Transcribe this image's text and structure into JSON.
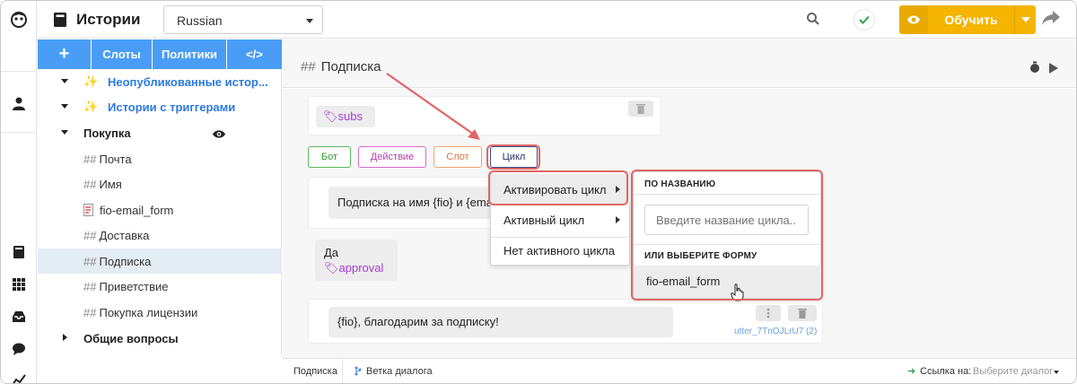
{
  "header": {
    "title": "Истории",
    "language": "Russian",
    "train_label": "Обучить"
  },
  "story_toolbar": {
    "add": "+",
    "slots": "Слоты",
    "policies": "Политики",
    "code": "</>"
  },
  "tree": {
    "unpublished": "Неопубликованные истор...",
    "triggers": "Истории с триггерами",
    "purchase": "Покупка",
    "items": [
      "Почта",
      "Имя",
      "fio-email_form",
      "Доставка",
      "Подписка",
      "Приветствие",
      "Покупка лицензии"
    ],
    "general": "Общие вопросы",
    "hash": "##",
    "sparkle": "✨"
  },
  "story": {
    "title": "Подписка",
    "hash": "##",
    "intent_tag": "subs",
    "chips": [
      "Бот",
      "Действие",
      "Слот",
      "Цикл"
    ],
    "bot_message": "Подписка на имя {fio} и {ema",
    "user_text": "Да",
    "user_tag": "approval",
    "bot_thanks": "{fio}, благодарим за подписку!",
    "utter_ref": "utter_7TnOJLrU7",
    "utter_count": "(2)"
  },
  "cycle_menu": {
    "items": [
      "Активировать цикл",
      "Активный цикл",
      "Нет активного цикла"
    ]
  },
  "sub_menu": {
    "by_name": "ПО НАЗВАНИЮ",
    "search_placeholder": "Введите название цикла...",
    "or_choose": "ИЛИ ВЫБЕРИТЕ ФОРМУ",
    "form": "fio-email_form"
  },
  "footer": {
    "story": "Подписка",
    "branch": "Ветка диалога",
    "link_label": "Ссылка на:",
    "link_placeholder": "Выберите диалог"
  },
  "colors": {
    "accent_blue": "#4a9df6",
    "train_yellow": "#f4b400",
    "tag_purple": "#a63bd1",
    "highlight_red": "#e06666"
  }
}
